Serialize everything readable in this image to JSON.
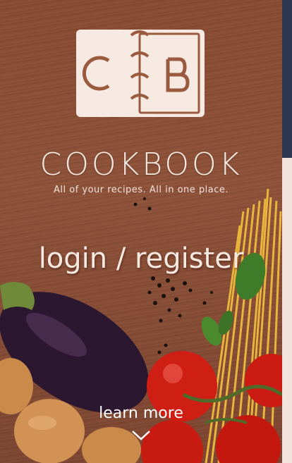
{
  "hero": {
    "logo_letters": {
      "left": "C",
      "right": "B"
    },
    "brand_title": "COOKBOOK",
    "tagline": "All of your recipes. All in one place.",
    "login_link": "login / register",
    "learn_more": "learn more"
  },
  "icons": {
    "scroll_down": "chevron-down-icon"
  },
  "colors": {
    "wood": "#8a4a32",
    "text": "#f6e9e1",
    "scroll_thumb": "#2c3650",
    "scroll_track": "#f2e4dc"
  }
}
